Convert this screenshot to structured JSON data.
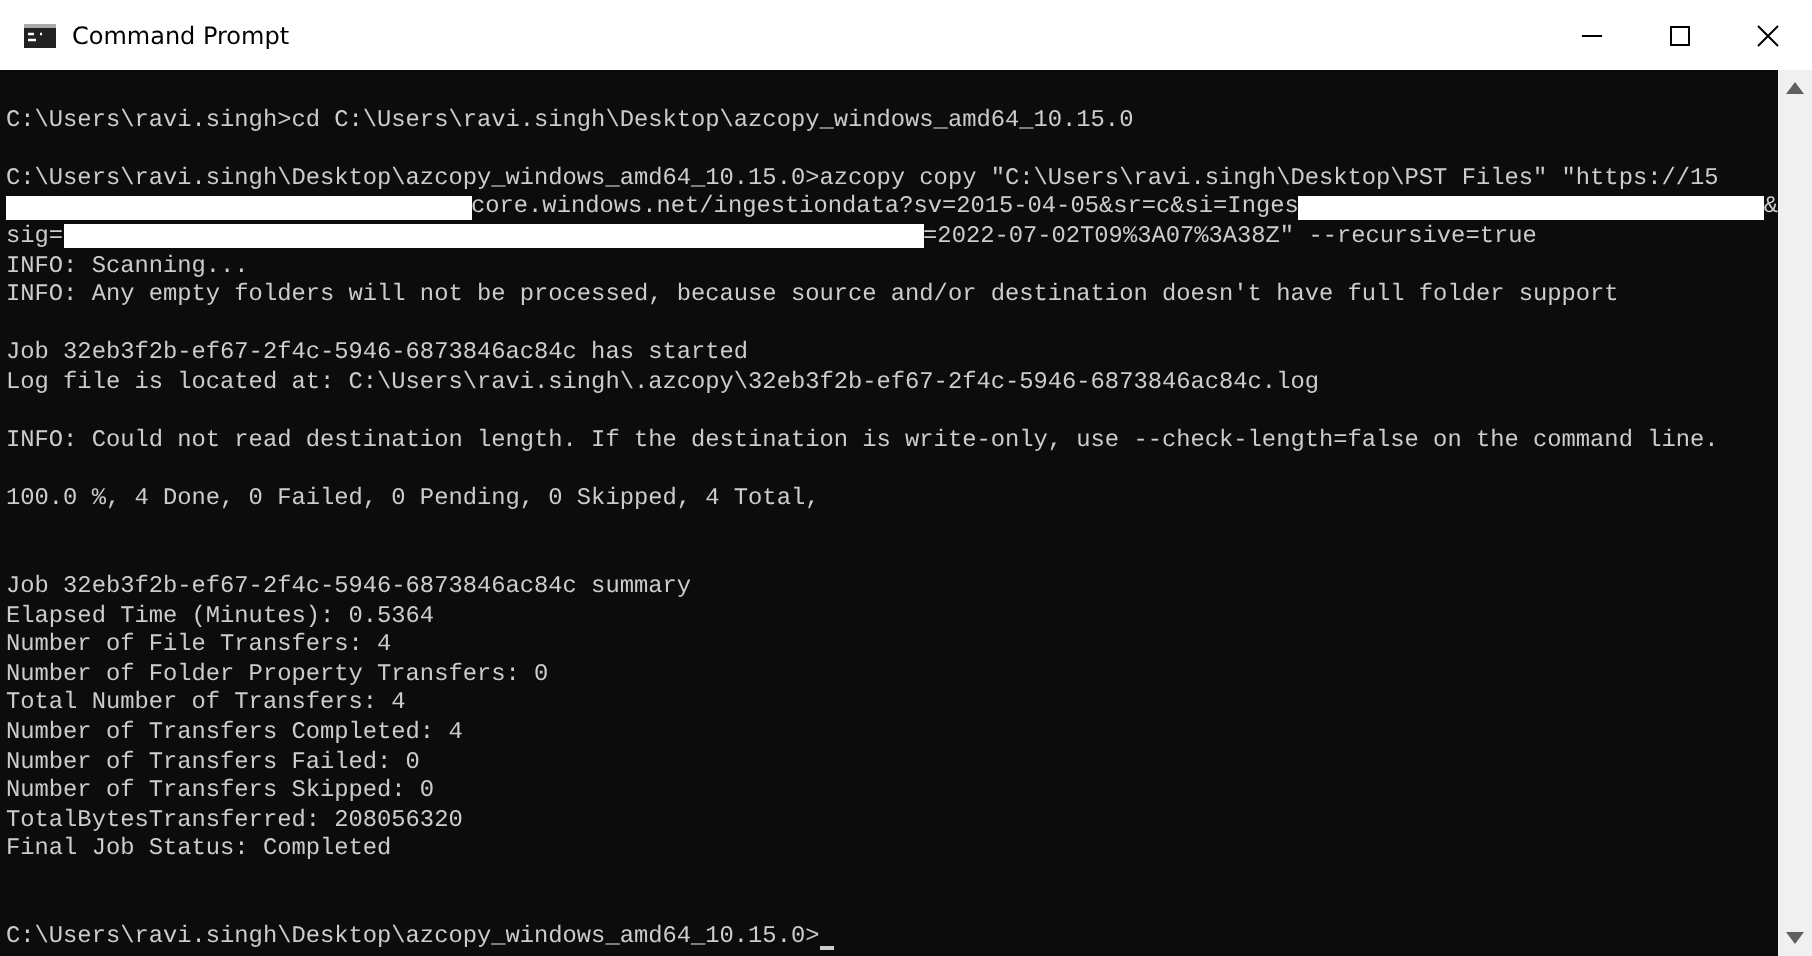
{
  "window": {
    "title": "Command Prompt"
  },
  "console": {
    "cursor": true,
    "lines": [
      {
        "kind": "blank"
      },
      {
        "kind": "text",
        "text": "C:\\Users\\ravi.singh>cd C:\\Users\\ravi.singh\\Desktop\\azcopy_windows_amd64_10.15.0"
      },
      {
        "kind": "blank"
      },
      {
        "kind": "text",
        "text": "C:\\Users\\ravi.singh\\Desktop\\azcopy_windows_amd64_10.15.0>azcopy copy \"C:\\Users\\ravi.singh\\Desktop\\PST Files\" \"https://15"
      },
      {
        "kind": "mixed",
        "parts": [
          {
            "kind": "redaction"
          },
          {
            "kind": "text",
            "text": "core.windows.net/ingestiondata?sv=2015-04-05&sr=c&si=Inges"
          },
          {
            "kind": "redaction"
          },
          {
            "kind": "text",
            "text": "&"
          }
        ]
      },
      {
        "kind": "mixed",
        "parts": [
          {
            "kind": "text",
            "text": "sig="
          },
          {
            "kind": "redaction"
          },
          {
            "kind": "text",
            "text": "=2022-07-02T09%3A07%3A38Z\" --recursive=true"
          }
        ]
      },
      {
        "kind": "text",
        "text": "INFO: Scanning..."
      },
      {
        "kind": "text",
        "text": "INFO: Any empty folders will not be processed, because source and/or destination doesn't have full folder support"
      },
      {
        "kind": "blank"
      },
      {
        "kind": "text",
        "text": "Job 32eb3f2b-ef67-2f4c-5946-6873846ac84c has started"
      },
      {
        "kind": "text",
        "text": "Log file is located at: C:\\Users\\ravi.singh\\.azcopy\\32eb3f2b-ef67-2f4c-5946-6873846ac84c.log"
      },
      {
        "kind": "blank"
      },
      {
        "kind": "text",
        "text": "INFO: Could not read destination length. If the destination is write-only, use --check-length=false on the command line."
      },
      {
        "kind": "blank"
      },
      {
        "kind": "text",
        "text": "100.0 %, 4 Done, 0 Failed, 0 Pending, 0 Skipped, 4 Total,"
      },
      {
        "kind": "blank"
      },
      {
        "kind": "blank"
      },
      {
        "kind": "text",
        "text": "Job 32eb3f2b-ef67-2f4c-5946-6873846ac84c summary"
      },
      {
        "kind": "text",
        "text": "Elapsed Time (Minutes): 0.5364"
      },
      {
        "kind": "text",
        "text": "Number of File Transfers: 4"
      },
      {
        "kind": "text",
        "text": "Number of Folder Property Transfers: 0"
      },
      {
        "kind": "text",
        "text": "Total Number of Transfers: 4"
      },
      {
        "kind": "text",
        "text": "Number of Transfers Completed: 4"
      },
      {
        "kind": "text",
        "text": "Number of Transfers Failed: 0"
      },
      {
        "kind": "text",
        "text": "Number of Transfers Skipped: 0"
      },
      {
        "kind": "text",
        "text": "TotalBytesTransferred: 208056320"
      },
      {
        "kind": "text",
        "text": "Final Job Status: Completed"
      },
      {
        "kind": "blank"
      },
      {
        "kind": "blank"
      },
      {
        "kind": "text",
        "text": "C:\\Users\\ravi.singh\\Desktop\\azcopy_windows_amd64_10.15.0>"
      }
    ]
  }
}
